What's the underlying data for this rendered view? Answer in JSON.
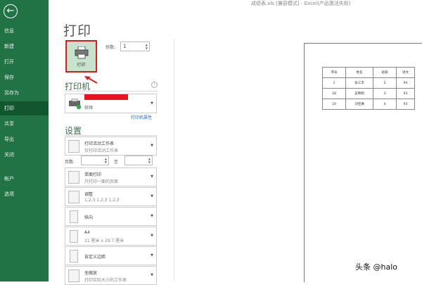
{
  "window": {
    "title": "成绩表.xls [兼容模式] - Excel(产品激活失败)"
  },
  "sidebar": {
    "back_icon": "back-arrow-icon",
    "items": [
      {
        "label": "信息",
        "active": false
      },
      {
        "label": "新建",
        "active": false
      },
      {
        "label": "打开",
        "active": false
      },
      {
        "label": "保存",
        "active": false
      },
      {
        "label": "另存为",
        "active": false
      },
      {
        "label": "打印",
        "active": true
      },
      {
        "label": "共享",
        "active": false
      },
      {
        "label": "导出",
        "active": false
      },
      {
        "label": "关闭",
        "active": false
      },
      {
        "label": "帐户",
        "active": false
      },
      {
        "label": "选项",
        "active": false
      }
    ],
    "colors": {
      "background": "#217346",
      "active": "#10572f"
    }
  },
  "main": {
    "title": "打印",
    "print_button": {
      "label": "打印",
      "icon": "printer-icon"
    },
    "copies": {
      "label": "份数:",
      "value": "1"
    }
  },
  "printer": {
    "section_title": "打印机",
    "status": "就绪",
    "properties_link": "打印机属性"
  },
  "settings": {
    "section_title": "设置",
    "print_what": {
      "title": "打印活动工作表",
      "subtitle": "仅打印活动工作表"
    },
    "pages": {
      "label": "页数:",
      "to_label": "至",
      "from_value": "",
      "to_value": ""
    },
    "sides": {
      "title": "单面打印",
      "subtitle": "只打印一面的页面"
    },
    "collate": {
      "title": "调整",
      "subtitle": "1,2,3    1,2,3    1,2,3"
    },
    "orientation": {
      "title": "纵向"
    },
    "paper": {
      "title": "A4",
      "subtitle": "21 厘米 x 29.7 厘米"
    },
    "margins": {
      "title": "自定义边距"
    },
    "scaling": {
      "title": "无缩放",
      "subtitle": "打印实际大小的工作表"
    }
  },
  "preview": {
    "headers": [
      "序号",
      "姓名",
      "班级",
      "语文"
    ],
    "rows": [
      [
        "1",
        "张三丰",
        "2",
        "94"
      ],
      [
        "18",
        "吴映明",
        "3",
        "93"
      ],
      [
        "19",
        "刘佳琳",
        "4",
        "93"
      ]
    ]
  },
  "watermark": "头条 @halo",
  "accent": {
    "highlight_border": "#d02121",
    "redaction": "#e8151c"
  }
}
